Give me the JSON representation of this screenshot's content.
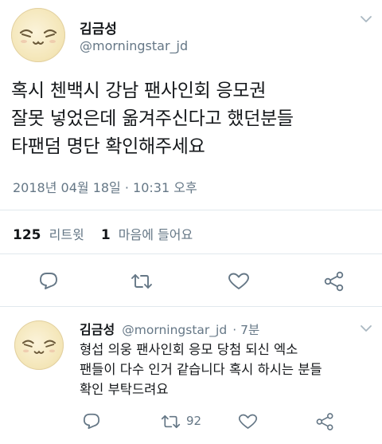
{
  "main_tweet": {
    "author_name": "김금성",
    "author_handle": "@morningstar_jd",
    "text_lines": [
      "혹시 첸백시 강남 팬사인회 응모권",
      "잘못 넣었은데 옮겨주신다고 했던분들",
      "타팬덤 명단 확인해주세요"
    ],
    "timestamp": "2018년 04월 18일 · 10:31 오후",
    "retweet_count": "125",
    "retweet_label": "리트윗",
    "like_count": "1",
    "like_label": "마음에 들어요",
    "icons": [
      "reply-icon",
      "retweet-icon",
      "like-icon",
      "share-icon"
    ]
  },
  "reply_tweet": {
    "author_name": "김금성",
    "author_handle": "@morningstar_jd",
    "time_ago": "· 7분",
    "text_lines": [
      "형섭 의웅 팬사인회 응모 당첨 되신 엑소",
      "팬들이 다수 인거 같습니다 혹시 하시는 분들",
      "확인 부탁드려요"
    ],
    "retweet_count": "92",
    "icons": [
      "reply-icon",
      "retweet-icon",
      "like-icon",
      "share-icon"
    ]
  },
  "colors": {
    "text": "#14171a",
    "secondary": "#657786",
    "icon": "#657786",
    "divider": "#e1e8ed",
    "avatar": "#f4e6b8"
  }
}
